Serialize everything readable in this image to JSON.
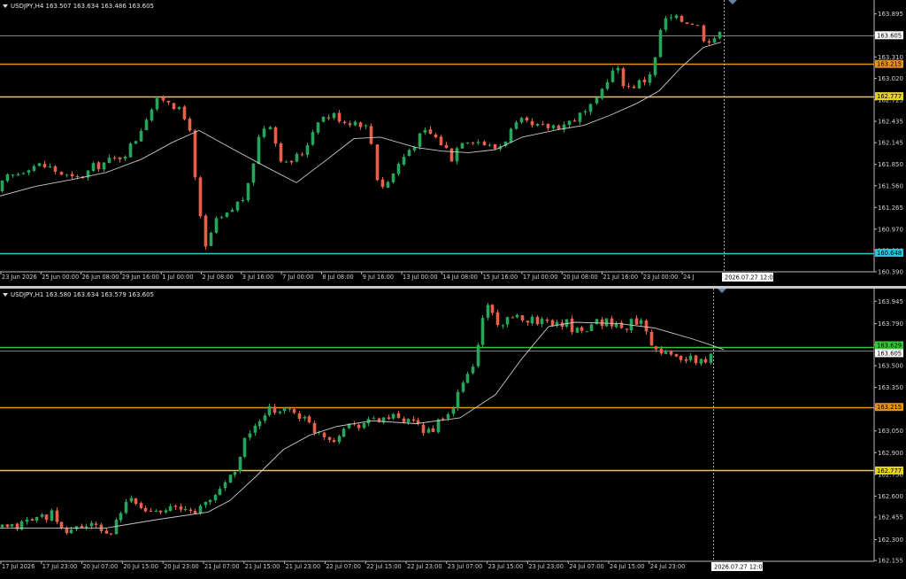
{
  "colors": {
    "background": "#000000",
    "bull": "#26a65b",
    "bear": "#e8604c",
    "ma": "#c8c8c8",
    "grid_text": "#d0d0d0",
    "bid_line": "#808080",
    "orange": "#e8901e",
    "yellow": "#e6d21e",
    "cyan": "#28c8dc",
    "green": "#32c832"
  },
  "charts": [
    {
      "id": "h4",
      "header": "USDJPY,H4  163.507 163.634 163.486 163.605",
      "y_min": 160.39,
      "y_max": 164.06,
      "y_ticks": [
        "163.895",
        "163.605",
        "163.310",
        "163.020",
        "162.725",
        "162.435",
        "162.145",
        "161.850",
        "161.560",
        "161.265",
        "160.970",
        "160.680",
        "160.390"
      ],
      "x_ticks": [
        "23 Jun 2026",
        "25 Jun 00:00",
        "26 Jun 08:00",
        "29 Jun 16:00",
        "1 Jul 00:00",
        "2 Jul 08:00",
        "3 Jul 16:00",
        "7 Jul 00:00",
        "8 Jul 08:00",
        "9 Jul 16:00",
        "13 Jul 00:00",
        "14 Jul 08:00",
        "15 Jul 16:00",
        "17 Jul 00:00",
        "20 Jul 08:00",
        "21 Jul 16:00",
        "23 Jul 00:00",
        "24 J"
      ],
      "crosshair_label": "2026.07.27 12:00",
      "levels": [
        {
          "name": "current",
          "value": 163.605,
          "label": "163.605",
          "color": "#808080",
          "label_bg": "#ffffff",
          "label_fg": "#000000"
        },
        {
          "name": "orange",
          "value": 163.215,
          "label": "163.215",
          "color": "#e8901e",
          "label_bg": "#e8901e",
          "label_fg": "#000000"
        },
        {
          "name": "yellow",
          "value": 162.777,
          "label": "162.777",
          "color": "#e6d21e",
          "label_bg": "#e6d21e",
          "label_fg": "#000000"
        },
        {
          "name": "cyan",
          "value": 160.648,
          "label": "160.648",
          "color": "#28c8dc",
          "label_bg": "#28c8dc",
          "label_fg": "#000000"
        }
      ],
      "candle_path": [
        [
          0,
          161.44
        ],
        [
          12,
          161.65
        ],
        [
          25,
          161.72
        ],
        [
          38,
          161.83
        ],
        [
          50,
          161.84
        ],
        [
          62,
          161.81
        ],
        [
          75,
          161.72
        ],
        [
          88,
          161.64
        ],
        [
          100,
          161.7
        ],
        [
          112,
          161.82
        ],
        [
          125,
          161.88
        ],
        [
          138,
          161.93
        ],
        [
          150,
          162.04
        ],
        [
          162,
          162.25
        ],
        [
          170,
          162.48
        ],
        [
          180,
          162.66
        ],
        [
          190,
          162.75
        ],
        [
          198,
          162.72
        ],
        [
          208,
          162.56
        ],
        [
          220,
          162.36
        ],
        [
          228,
          161.36
        ],
        [
          238,
          160.7
        ],
        [
          248,
          161.05
        ],
        [
          262,
          161.15
        ],
        [
          272,
          161.3
        ],
        [
          285,
          161.45
        ],
        [
          292,
          161.88
        ],
        [
          300,
          162.3
        ],
        [
          310,
          162.44
        ],
        [
          320,
          162.0
        ],
        [
          330,
          161.82
        ],
        [
          338,
          161.95
        ],
        [
          345,
          161.96
        ],
        [
          355,
          162.2
        ],
        [
          365,
          162.48
        ],
        [
          375,
          162.5
        ],
        [
          385,
          162.52
        ],
        [
          395,
          162.44
        ],
        [
          410,
          162.43
        ],
        [
          418,
          162.4
        ],
        [
          425,
          162.18
        ],
        [
          432,
          161.64
        ],
        [
          440,
          161.54
        ],
        [
          448,
          161.7
        ],
        [
          458,
          161.9
        ],
        [
          468,
          162.06
        ],
        [
          478,
          162.2
        ],
        [
          488,
          162.3
        ],
        [
          498,
          162.21
        ],
        [
          508,
          162.1
        ],
        [
          516,
          161.94
        ],
        [
          528,
          162.2
        ],
        [
          540,
          162.2
        ],
        [
          552,
          162.14
        ],
        [
          562,
          162.06
        ],
        [
          572,
          162.12
        ],
        [
          582,
          162.3
        ],
        [
          595,
          162.42
        ],
        [
          608,
          162.35
        ],
        [
          620,
          162.35
        ],
        [
          632,
          162.38
        ],
        [
          645,
          162.4
        ],
        [
          657,
          162.49
        ],
        [
          670,
          162.56
        ],
        [
          680,
          162.7
        ],
        [
          688,
          162.94
        ],
        [
          695,
          163.1
        ],
        [
          705,
          163.12
        ],
        [
          712,
          162.9
        ],
        [
          722,
          162.93
        ],
        [
          735,
          163.0
        ],
        [
          745,
          163.2
        ],
        [
          752,
          163.67
        ],
        [
          760,
          163.84
        ],
        [
          770,
          163.82
        ],
        [
          782,
          163.8
        ],
        [
          792,
          163.78
        ],
        [
          802,
          163.55
        ],
        [
          812,
          163.58
        ],
        [
          818,
          163.605
        ]
      ],
      "candle_step": 6.05,
      "ma_path": [
        [
          0,
          161.42
        ],
        [
          40,
          161.55
        ],
        [
          80,
          161.64
        ],
        [
          120,
          161.74
        ],
        [
          160,
          161.92
        ],
        [
          195,
          162.15
        ],
        [
          225,
          162.31
        ],
        [
          260,
          162.08
        ],
        [
          300,
          161.82
        ],
        [
          335,
          161.6
        ],
        [
          370,
          161.92
        ],
        [
          400,
          162.2
        ],
        [
          430,
          162.22
        ],
        [
          470,
          162.08
        ],
        [
          500,
          162.03
        ],
        [
          530,
          162.01
        ],
        [
          560,
          162.05
        ],
        [
          590,
          162.22
        ],
        [
          630,
          162.32
        ],
        [
          660,
          162.38
        ],
        [
          690,
          162.52
        ],
        [
          720,
          162.68
        ],
        [
          745,
          162.85
        ],
        [
          770,
          163.17
        ],
        [
          795,
          163.44
        ],
        [
          815,
          163.51
        ]
      ]
    },
    {
      "id": "h1",
      "header": "USDJPY,H1  163.580 163.634 163.579 163.605",
      "y_min": 162.15,
      "y_max": 164.02,
      "y_ticks": [
        "163.945",
        "163.790",
        "163.645",
        "163.500",
        "163.350",
        "163.205",
        "163.050",
        "162.900",
        "162.750",
        "162.600",
        "162.455",
        "162.300",
        "162.155"
      ],
      "x_ticks": [
        "17 Jul 2026",
        "17 Jul 23:00",
        "20 Jul 07:00",
        "20 Jul 15:00",
        "20 Jul 23:00",
        "21 Jul 07:00",
        "21 Jul 15:00",
        "21 Jul 23:00",
        "22 Jul 07:00",
        "22 Jul 15:00",
        "22 Jul 23:00",
        "23 Jul 07:00",
        "23 Jul 15:00",
        "23 Jul 23:00",
        "24 Jul 07:00",
        "24 Jul 15:00",
        "24 Jul 23:00"
      ],
      "crosshair_label": "2026.07.27 12:00",
      "levels": [
        {
          "name": "green",
          "value": 163.629,
          "label": "163.629",
          "color": "#32c832",
          "label_bg": "#32c832",
          "label_fg": "#000000"
        },
        {
          "name": "current",
          "value": 163.605,
          "label": "163.605",
          "color": "#808080",
          "label_bg": "#ffffff",
          "label_fg": "#000000"
        },
        {
          "name": "orange",
          "value": 163.215,
          "label": "163.215",
          "color": "#e8901e",
          "label_bg": "#e8901e",
          "label_fg": "#000000"
        },
        {
          "name": "yellow",
          "value": 162.777,
          "label": "162.777",
          "color": "#e6d21e",
          "label_bg": "#e6d21e",
          "label_fg": "#000000"
        }
      ],
      "candle_path": [
        [
          0,
          162.38
        ],
        [
          20,
          162.38
        ],
        [
          40,
          162.44
        ],
        [
          55,
          162.46
        ],
        [
          65,
          162.48
        ],
        [
          72,
          162.35
        ],
        [
          85,
          162.37
        ],
        [
          100,
          162.4
        ],
        [
          115,
          162.38
        ],
        [
          130,
          162.34
        ],
        [
          140,
          162.45
        ],
        [
          150,
          162.58
        ],
        [
          160,
          162.55
        ],
        [
          170,
          162.49
        ],
        [
          182,
          162.52
        ],
        [
          195,
          162.52
        ],
        [
          210,
          162.5
        ],
        [
          225,
          162.5
        ],
        [
          240,
          162.55
        ],
        [
          252,
          162.64
        ],
        [
          265,
          162.74
        ],
        [
          275,
          162.84
        ],
        [
          282,
          162.98
        ],
        [
          290,
          163.08
        ],
        [
          300,
          163.1
        ],
        [
          310,
          163.19
        ],
        [
          320,
          163.2
        ],
        [
          330,
          163.2
        ],
        [
          340,
          163.18
        ],
        [
          350,
          163.12
        ],
        [
          360,
          163.06
        ],
        [
          370,
          163.04
        ],
        [
          380,
          162.98
        ],
        [
          390,
          163.05
        ],
        [
          400,
          163.1
        ],
        [
          410,
          163.1
        ],
        [
          420,
          163.12
        ],
        [
          430,
          163.12
        ],
        [
          440,
          163.14
        ],
        [
          450,
          163.14
        ],
        [
          460,
          163.11
        ],
        [
          470,
          163.1
        ],
        [
          480,
          163.07
        ],
        [
          490,
          163.05
        ],
        [
          500,
          163.1
        ],
        [
          510,
          163.13
        ],
        [
          520,
          163.26
        ],
        [
          530,
          163.4
        ],
        [
          540,
          163.5
        ],
        [
          548,
          163.74
        ],
        [
          555,
          163.94
        ],
        [
          562,
          163.86
        ],
        [
          570,
          163.78
        ],
        [
          585,
          163.82
        ],
        [
          600,
          163.83
        ],
        [
          615,
          163.81
        ],
        [
          630,
          163.8
        ],
        [
          645,
          163.8
        ],
        [
          655,
          163.74
        ],
        [
          665,
          163.76
        ],
        [
          678,
          163.8
        ],
        [
          690,
          163.81
        ],
        [
          700,
          163.78
        ],
        [
          710,
          163.76
        ],
        [
          720,
          163.8
        ],
        [
          732,
          163.84
        ],
        [
          740,
          163.66
        ],
        [
          748,
          163.63
        ],
        [
          760,
          163.57
        ],
        [
          772,
          163.56
        ],
        [
          785,
          163.54
        ],
        [
          795,
          163.52
        ],
        [
          805,
          163.55
        ],
        [
          812,
          163.58
        ],
        [
          818,
          163.605
        ]
      ],
      "candle_step": 5.6,
      "ma_path": [
        [
          0,
          162.38
        ],
        [
          60,
          162.38
        ],
        [
          120,
          162.38
        ],
        [
          180,
          162.44
        ],
        [
          235,
          162.49
        ],
        [
          260,
          162.57
        ],
        [
          290,
          162.74
        ],
        [
          320,
          162.92
        ],
        [
          350,
          163.02
        ],
        [
          380,
          163.08
        ],
        [
          420,
          163.12
        ],
        [
          470,
          163.1
        ],
        [
          520,
          163.14
        ],
        [
          560,
          163.3
        ],
        [
          590,
          163.55
        ],
        [
          620,
          163.77
        ],
        [
          650,
          163.8
        ],
        [
          700,
          163.79
        ],
        [
          740,
          163.76
        ],
        [
          780,
          163.69
        ],
        [
          805,
          163.64
        ],
        [
          818,
          163.61
        ]
      ]
    }
  ]
}
